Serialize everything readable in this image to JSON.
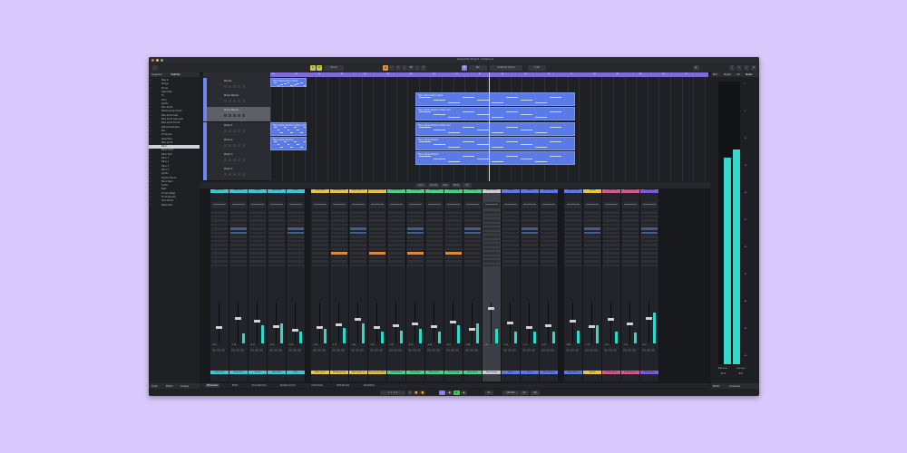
{
  "window": {
    "title": "Cubase Pro Project - Cubase 14",
    "traffic_colors": [
      "#ee5f58",
      "#f6be4f",
      "#5fc454"
    ]
  },
  "toolbar": {
    "touch_label": "Touch",
    "snap_label": "Bar",
    "adapt_label": "Adapt to Zoom",
    "quantize_label": "1/16"
  },
  "left_panel": {
    "tabs": [
      "Inspector",
      "Visibility"
    ],
    "tracks": [
      "Bass In",
      "Strings",
      "Drums",
      "Open Hats",
      "FX",
      "Kicks",
      "Synths",
      "Main Synth",
      "Warbling Lead Synth",
      "Main Synth Lead",
      "Main Synth Lead pads",
      "Main Synth Chords",
      "Refreshment Bass",
      "Pad",
      "FX Reverb",
      "Deep Bass",
      "Main Synth",
      "Piano",
      "Piano Chord",
      "Piano Verb",
      "Piano 1",
      "Piano 2",
      "Piano 3",
      "Piano 4",
      "Synths",
      "Rhythm Pianos",
      "Piano Stack",
      "Synths",
      "Beat",
      "FX Vox Delays",
      "FX Ab Reverbs",
      "Hard Kicked",
      "Master Bus"
    ],
    "selected_index": 17,
    "bottom_tabs": [
      "Track",
      "Editor",
      "Groups"
    ]
  },
  "track_headers": [
    {
      "name": "Pianos"
    },
    {
      "name": "Piano Stems"
    },
    {
      "name": "Piano Stems"
    },
    {
      "name": "Piano 1"
    },
    {
      "name": "Piano 2"
    },
    {
      "name": "Piano 3"
    },
    {
      "name": "Piano 4"
    }
  ],
  "ruler": {
    "marks": [
      "25",
      "29",
      "33",
      "37",
      "41",
      "45",
      "49",
      "53",
      "57",
      "61",
      "65",
      "69",
      "73",
      "77",
      "81",
      "85",
      "89",
      "93",
      "97"
    ]
  },
  "clips": [
    {
      "label": "Piano Stems Piano stems"
    },
    {
      "label": "Piano Stems Piano stems"
    },
    {
      "label": "Piano stems Rhythm 2 Piano rad"
    },
    {
      "label": "Piano stems Rhythm 3 Piano rad"
    },
    {
      "label": "Piano stems Rhythm 4 Piano rad"
    },
    {
      "label": "Piano stems Rhythm"
    },
    {
      "label": "Piano stems Rhythm"
    },
    {
      "label": "Piano stems Rhythm"
    }
  ],
  "mixer": {
    "toolbar": {
      "link_label": "Link",
      "q_label": "Q-Link",
      "bus_label": "Bus",
      "mode_label": "Mute",
      "fx_label": "FX"
    },
    "channels": [
      {
        "name": "Piano 09-3",
        "color": "#3fc4d8",
        "fader": 0.38,
        "meter": 0.0,
        "db": "-6.02"
      },
      {
        "name": "Piano 09-3",
        "color": "#3fc4d8",
        "fader": 0.62,
        "meter": 0.25,
        "db": "-2.18"
      },
      {
        "name": "Drums",
        "color": "#3fc4d8",
        "fader": 0.55,
        "meter": 0.45,
        "db": "-4.21"
      },
      {
        "name": "Open Hats",
        "color": "#3fc4d8",
        "fader": 0.42,
        "meter": 0.48,
        "db": "-8.00"
      },
      {
        "name": "Kicks",
        "color": "#3fc4d8",
        "fader": 0.32,
        "meter": 0.3,
        "db": "-10.4"
      },
      {
        "name": "Main Synth",
        "color": "#e8c34a",
        "fader": 0.4,
        "meter": 0.35,
        "db": "-7.66"
      },
      {
        "name": "Warbling Lead",
        "color": "#e8c34a",
        "fader": 0.45,
        "meter": 0.38,
        "db": "-6.10"
      },
      {
        "name": "Main Synth Ld",
        "color": "#e8c34a",
        "fader": 0.58,
        "meter": 0.5,
        "db": "-3.45"
      },
      {
        "name": "Refreshment Bass",
        "color": "#e8c34a",
        "fader": 0.38,
        "meter": 0.3,
        "db": "-9.02"
      },
      {
        "name": "FX Ambience",
        "color": "#47d18a",
        "fader": 0.44,
        "meter": 0.32,
        "db": "-7.81"
      },
      {
        "name": "Deep Bass",
        "color": "#47d18a",
        "fader": 0.48,
        "meter": 0.35,
        "db": "-6.25"
      },
      {
        "name": "Main Synth",
        "color": "#47d18a",
        "fader": 0.41,
        "meter": 0.28,
        "db": "-8.44"
      },
      {
        "name": "Kicks Strings",
        "color": "#47d18a",
        "fader": 0.52,
        "meter": 0.45,
        "db": "-5.01"
      },
      {
        "name": "Piano Store",
        "color": "#47d18a",
        "fader": 0.35,
        "meter": 0.48,
        "db": "-9.88"
      },
      {
        "name": "Piano Stems",
        "color": "#c8ccd2",
        "fader": 0.85,
        "meter": 0.35,
        "db": "0.00"
      },
      {
        "name": "Piano",
        "color": "#5b78e8",
        "fader": 0.5,
        "meter": 0.3,
        "db": "-5.50"
      },
      {
        "name": "Piano",
        "color": "#5b78e8",
        "fader": 0.4,
        "meter": 0.3,
        "db": "-7.12"
      },
      {
        "name": "Piano Pianos",
        "color": "#5b78e8",
        "fader": 0.43,
        "meter": 0.28,
        "db": "-6.60"
      },
      {
        "name": "Piano Pianos",
        "color": "#5b78e8",
        "fader": 0.55,
        "meter": 0.32,
        "db": "-4.88"
      },
      {
        "name": "Synths",
        "color": "#e8c34a",
        "fader": 0.42,
        "meter": 0.44,
        "db": "-7.35"
      },
      {
        "name": "FX Vox Delay",
        "color": "#d65b8c",
        "fader": 0.6,
        "meter": 0.3,
        "db": "-3.02"
      },
      {
        "name": "FX Ab Reverb",
        "color": "#d65b8c",
        "fader": 0.48,
        "meter": 0.26,
        "db": "-5.70"
      },
      {
        "name": "Master Bus",
        "color": "#7b5ce0",
        "fader": 0.62,
        "meter": 0.75,
        "db": "0.00"
      }
    ]
  },
  "bottom_tabs": [
    "MixConsole",
    "Editor",
    "Drum Machine",
    "Sample Control",
    "Chord Pads",
    "MIDI Remote",
    "Modulators"
  ],
  "active_bottom_tab": 0,
  "transport": {
    "position": "1. 1. 1. 0",
    "bar": "97",
    "tempo": "120.000",
    "signature": "4/4",
    "tap_label": "Tap"
  },
  "right_panel": {
    "tabs": [
      "MIX",
      "Media",
      "CR",
      "Meter"
    ],
    "scale": [
      "0",
      "-6",
      "-12",
      "-18",
      "-24",
      "-30",
      "-36",
      "-42",
      "-48",
      "-54",
      "-60"
    ],
    "meter_left": 0.73,
    "meter_right": 0.76,
    "readouts": [
      "-10.1",
      "-8.9"
    ],
    "labels": [
      "RMS Peak",
      "Peak Max"
    ],
    "bottom_tabs": [
      "Meter",
      "Loudness"
    ]
  }
}
